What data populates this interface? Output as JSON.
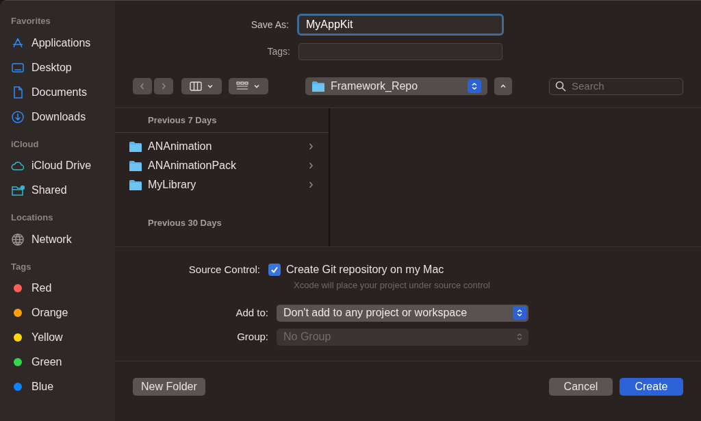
{
  "sidebar": {
    "sections": [
      {
        "title": "Favorites",
        "items": [
          {
            "label": "Applications",
            "kind": "apps"
          },
          {
            "label": "Desktop",
            "kind": "desktop"
          },
          {
            "label": "Documents",
            "kind": "document"
          },
          {
            "label": "Downloads",
            "kind": "download"
          }
        ]
      },
      {
        "title": "iCloud",
        "items": [
          {
            "label": "iCloud Drive",
            "kind": "cloud"
          },
          {
            "label": "Shared",
            "kind": "shared"
          }
        ]
      },
      {
        "title": "Locations",
        "items": [
          {
            "label": "Network",
            "kind": "network"
          }
        ]
      },
      {
        "title": "Tags",
        "items": [
          {
            "label": "Red",
            "kind": "tag",
            "color": "#ff5f57"
          },
          {
            "label": "Orange",
            "kind": "tag",
            "color": "#ff9f0a"
          },
          {
            "label": "Yellow",
            "kind": "tag",
            "color": "#ffd60a"
          },
          {
            "label": "Green",
            "kind": "tag",
            "color": "#32d74b"
          },
          {
            "label": "Blue",
            "kind": "tag",
            "color": "#0a84ff"
          }
        ]
      }
    ]
  },
  "save_as": {
    "label": "Save As:",
    "value": "MyAppKit"
  },
  "tags": {
    "label": "Tags:"
  },
  "toolbar": {
    "location": "Framework_Repo",
    "search": {
      "placeholder": "Search"
    }
  },
  "browser": {
    "groups": [
      {
        "title": "Previous 7 Days",
        "items": [
          {
            "name": "ANAnimation"
          },
          {
            "name": "ANAnimationPack"
          },
          {
            "name": "MyLibrary"
          }
        ]
      },
      {
        "title": "Previous 30 Days"
      }
    ]
  },
  "options": {
    "source_control": {
      "label": "Source Control:",
      "checkbox": "Create Git repository on my Mac",
      "checked": true,
      "hint": "Xcode will place your project under source control"
    },
    "add_to": {
      "label": "Add to:",
      "value": "Don't add to any project or workspace",
      "disabled": false
    },
    "group": {
      "label": "Group:",
      "value": "No Group",
      "disabled": true
    }
  },
  "buttons": {
    "new_folder": "New Folder",
    "cancel": "Cancel",
    "create": "Create"
  }
}
